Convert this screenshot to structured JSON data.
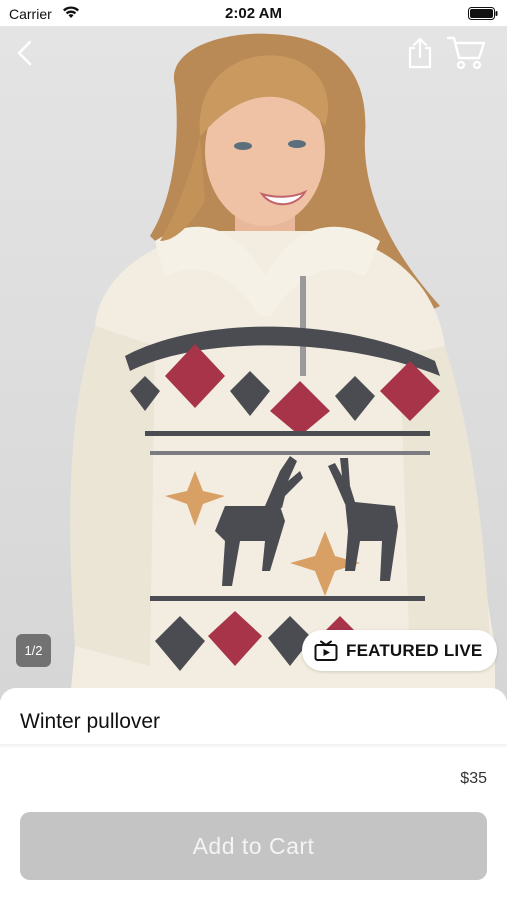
{
  "status_bar": {
    "carrier": "Carrier",
    "time": "2:02 AM"
  },
  "nav": {
    "back_icon": "chevron-left-icon",
    "share_icon": "share-icon",
    "cart_icon": "cart-icon"
  },
  "gallery": {
    "pager": "1/2",
    "featured_label": "FEATURED LIVE",
    "featured_icon": "tv-play-icon",
    "image_subject": "product photo"
  },
  "product": {
    "title": "Winter pullover",
    "price": "$35",
    "add_to_cart_label": "Add to Cart"
  },
  "colors": {
    "button_disabled_bg": "#c4c4c4",
    "button_text": "#f4f4f4",
    "sweater_red": "#a8344a",
    "sweater_gray": "#4a4c52",
    "sweater_orange": "#d9a066"
  }
}
